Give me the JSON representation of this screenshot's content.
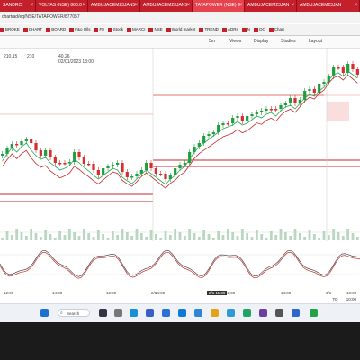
{
  "tabs": [
    {
      "label": "SANDRCI",
      "close": "×"
    },
    {
      "label": "VOLTAS (NSE) 868.0",
      "close": "×"
    },
    {
      "label": "AMBUJACEM23JAN5",
      "close": "×"
    },
    {
      "label": "AMBUJACEM23JAN5",
      "close": "×"
    },
    {
      "label": "TATAPOWER (NSE) 2",
      "close": "×",
      "active": true
    },
    {
      "label": "AMBUJACEM23JAN",
      "close": "×"
    },
    {
      "label": "AMBUJACEM23JAN",
      "close": "×"
    }
  ],
  "address": "chart/ad/eq/NSE/TATAPOWER/877057",
  "bookmarks": [
    "BROKE",
    "CHART",
    "BOARD",
    "F&o Olls",
    "FII",
    "Stock",
    "MARCI",
    "NSE",
    "World market",
    "TREND",
    "ADRs",
    "N",
    "OC",
    "Chart"
  ],
  "toolbar": {
    "items": [
      "5m",
      "Views",
      "Display",
      "Studies",
      "Layout"
    ]
  },
  "price_labels": {
    "line1": "210.15",
    "line2": "210",
    "line3": "40.26",
    "line4": "02/01/2023 13:00"
  },
  "chart_data": {
    "type": "candlestick",
    "x_tick_labels": [
      "12:00",
      "14:00",
      "12:00",
      "14:00",
      "2/1",
      "12:00",
      "14:00",
      "3/1",
      "10:00"
    ],
    "cursor_label": "2/1 11:30",
    "indicator": "stochastic",
    "colors": {
      "up": "#1e9e3c",
      "down": "#d32f2f",
      "ma_green": "#2aa65a",
      "ma_red": "#c62828",
      "resistance": "#c62828"
    }
  },
  "bottom_right": [
    "TD",
    "10:00"
  ],
  "taskbar": {
    "search_label": "Search"
  }
}
